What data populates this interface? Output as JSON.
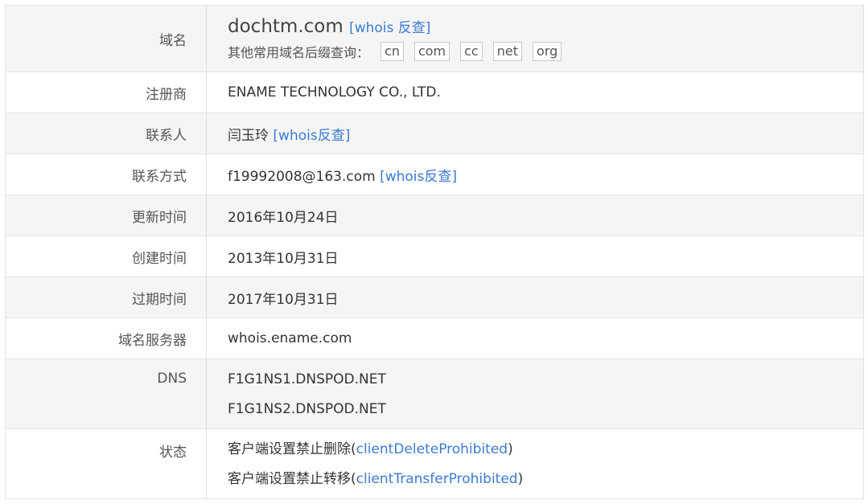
{
  "rows": {
    "domain": {
      "label": "域名",
      "name": "dochtm.com",
      "whois_link": "[whois 反查]",
      "suffix_label": "其他常用域名后缀查询：",
      "suffixes": [
        "cn",
        "com",
        "cc",
        "net",
        "org"
      ]
    },
    "registrar": {
      "label": "注册商",
      "value": "ENAME TECHNOLOGY CO., LTD."
    },
    "contact": {
      "label": "联系人",
      "value": "闫玉玲",
      "link": "[whois反查]"
    },
    "contact_method": {
      "label": "联系方式",
      "value": "f19992008@163.com",
      "link": "[whois反查]"
    },
    "updated": {
      "label": "更新时间",
      "value": "2016年10月24日"
    },
    "created": {
      "label": "创建时间",
      "value": "2013年10月31日"
    },
    "expires": {
      "label": "过期时间",
      "value": "2017年10月31日"
    },
    "name_server": {
      "label": "域名服务器",
      "value": "whois.ename.com"
    },
    "dns": {
      "label": "DNS",
      "values": [
        "F1G1NS1.DNSPOD.NET",
        "F1G1NS2.DNSPOD.NET"
      ]
    },
    "status": {
      "label": "状态",
      "items": [
        {
          "text": "客户端设置禁止删除",
          "open": "(",
          "code": "clientDeleteProhibited",
          "close": ")"
        },
        {
          "text": "客户端设置禁止转移",
          "open": "(",
          "code": "clientTransferProhibited",
          "close": ")"
        }
      ]
    }
  }
}
